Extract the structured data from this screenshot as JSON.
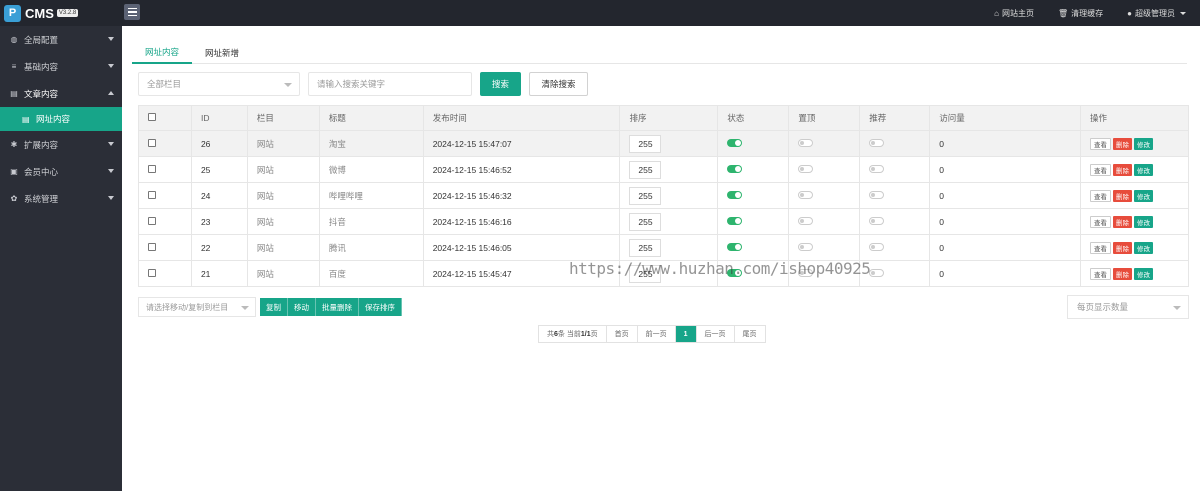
{
  "brand": {
    "logo_letter": "P",
    "name": "CMS",
    "version": "V3.2.8"
  },
  "topbar": {
    "links": [
      {
        "icon": "home-icon",
        "glyph": "⌂",
        "label": "网站主页"
      },
      {
        "icon": "trash-icon",
        "glyph": "🗑",
        "label": "清理缓存"
      },
      {
        "icon": "user-icon",
        "glyph": "●",
        "label": "超级管理员"
      }
    ]
  },
  "sidebar": {
    "items": [
      {
        "icon": "globe-icon",
        "glyph": "◍",
        "label": "全局配置"
      },
      {
        "icon": "sliders-icon",
        "glyph": "≡",
        "label": "基础内容"
      },
      {
        "icon": "file-icon",
        "glyph": "▤",
        "label": "文章内容"
      },
      {
        "icon": "file-icon",
        "glyph": "▤",
        "label": "网址内容"
      },
      {
        "icon": "puzzle-icon",
        "glyph": "✱",
        "label": "扩展内容"
      },
      {
        "icon": "lock-icon",
        "glyph": "▣",
        "label": "会员中心"
      },
      {
        "icon": "gear-icon",
        "glyph": "✿",
        "label": "系统管理"
      }
    ]
  },
  "tabs": [
    "网址内容",
    "网址新增"
  ],
  "filters": {
    "category_placeholder": "全部栏目",
    "keyword_placeholder": "请输入搜索关键字",
    "search_label": "搜索",
    "clear_label": "清除搜索"
  },
  "table": {
    "headers": [
      "ID",
      "栏目",
      "标题",
      "发布时间",
      "排序",
      "状态",
      "置顶",
      "推荐",
      "访问量",
      "操作"
    ],
    "rows": [
      {
        "id": "26",
        "category": "网站",
        "title": "淘宝",
        "time": "2024-12-15 15:47:07",
        "sort": "255",
        "views": "0"
      },
      {
        "id": "25",
        "category": "网站",
        "title": "微博",
        "time": "2024-12-15 15:46:52",
        "sort": "255",
        "views": "0"
      },
      {
        "id": "24",
        "category": "网站",
        "title": "哔哩哔哩",
        "time": "2024-12-15 15:46:32",
        "sort": "255",
        "views": "0"
      },
      {
        "id": "23",
        "category": "网站",
        "title": "抖音",
        "time": "2024-12-15 15:46:16",
        "sort": "255",
        "views": "0"
      },
      {
        "id": "22",
        "category": "网站",
        "title": "腾讯",
        "time": "2024-12-15 15:46:05",
        "sort": "255",
        "views": "0"
      },
      {
        "id": "21",
        "category": "网站",
        "title": "百度",
        "time": "2024-12-15 15:45:47",
        "sort": "255",
        "views": "0"
      }
    ],
    "ops": {
      "view": "查看",
      "delete": "删除",
      "edit": "修改"
    }
  },
  "watermark": "https://www.huzhan.com/ishop40925",
  "bulk": {
    "target_placeholder": "请选择移动/复制到栏目",
    "copy": "复制",
    "move": "移动",
    "batch_delete": "批量删除",
    "save_sort": "保存排序"
  },
  "per_page_placeholder": "每页显示数量",
  "pagination": {
    "summary_prefix": "共",
    "total": "6",
    "summary_mid": "条 当前",
    "page": "1/1",
    "summary_suffix": "页",
    "first": "首页",
    "prev": "前一页",
    "current": "1",
    "next": "后一页",
    "last": "尾页"
  },
  "colors": {
    "accent": "#17a589",
    "danger": "#e74c3c",
    "topbar": "#23262e",
    "sidebar": "#2b2e37"
  }
}
